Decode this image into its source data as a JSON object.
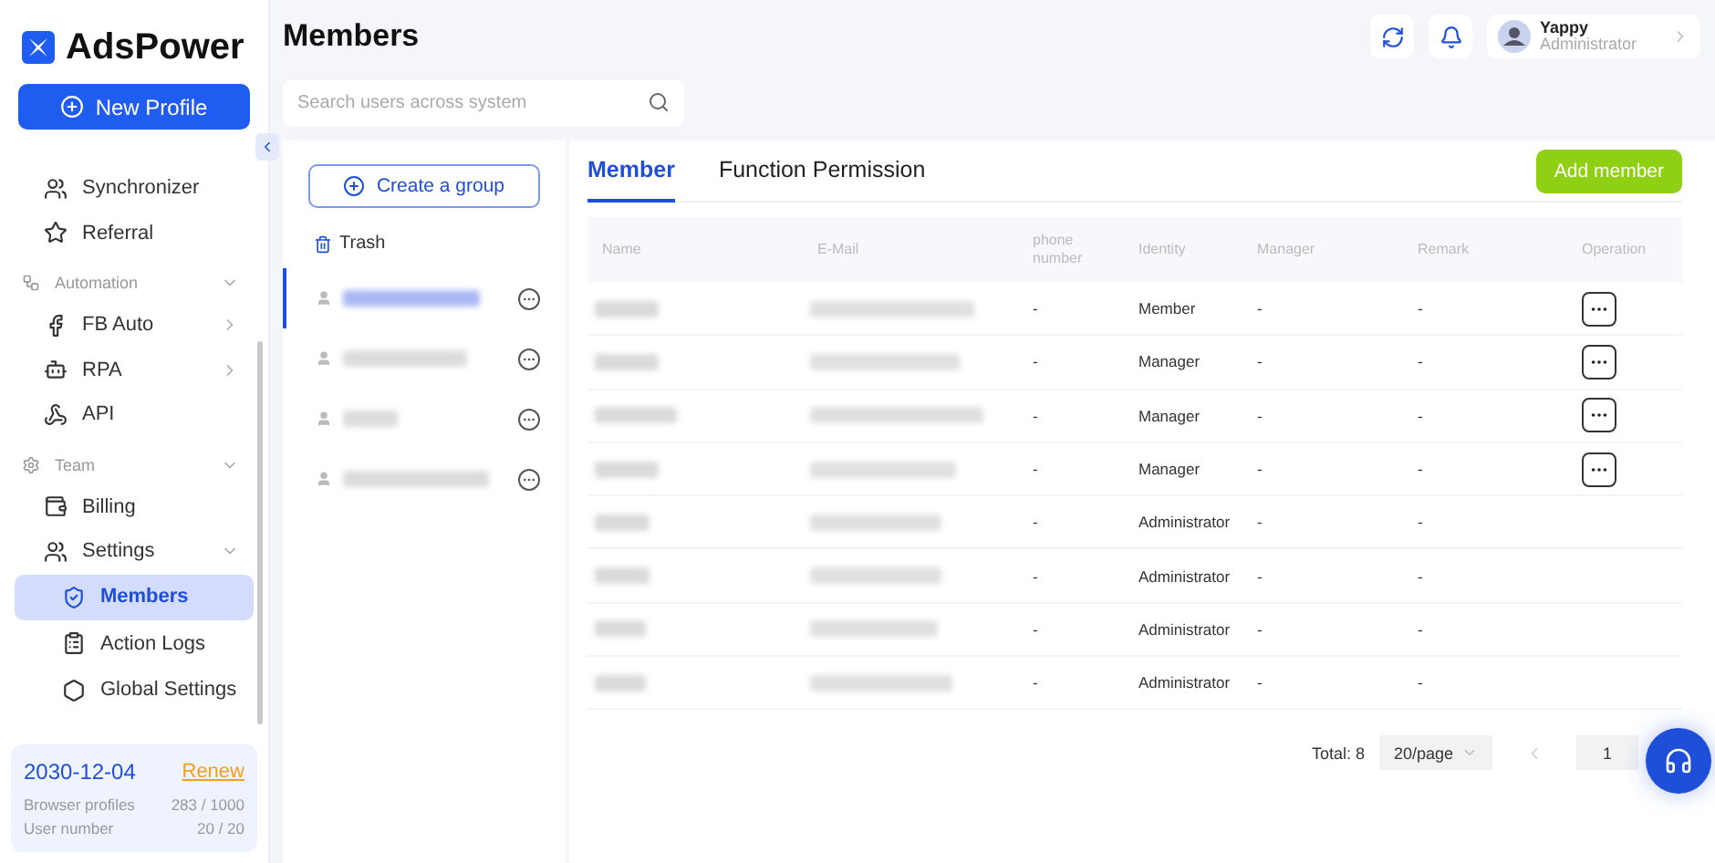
{
  "brand": "AdsPower",
  "new_profile": "New Profile",
  "nav": [
    {
      "kind": "item",
      "label": "Synchronizer",
      "selected": false
    },
    {
      "kind": "item",
      "label": "Referral",
      "selected": false
    },
    {
      "kind": "section",
      "label": "Automation",
      "expanded": true,
      "selected": false
    },
    {
      "kind": "item",
      "label": "FB Auto",
      "expanded": false,
      "selected": false
    },
    {
      "kind": "item",
      "label": "RPA",
      "expanded": false,
      "selected": false
    },
    {
      "kind": "item",
      "label": "API",
      "selected": false
    },
    {
      "kind": "section",
      "label": "Team",
      "expanded": true,
      "selected": false
    },
    {
      "kind": "item",
      "label": "Billing",
      "selected": false
    },
    {
      "kind": "item",
      "label": "Settings",
      "expanded": true,
      "selected": false
    },
    {
      "kind": "sub",
      "label": "Members",
      "selected": true
    },
    {
      "kind": "sub",
      "label": "Action Logs",
      "selected": false
    },
    {
      "kind": "sub",
      "label": "Global Settings",
      "selected": false
    }
  ],
  "plan": {
    "expiry": "2030-12-04",
    "renew": "Renew",
    "stats": [
      {
        "label": "Browser profiles",
        "value": "283 / 1000"
      },
      {
        "label": "User number",
        "value": "20 / 20"
      }
    ]
  },
  "page_title": "Members",
  "search": {
    "placeholder": "Search users across system"
  },
  "user": {
    "name": "Yappy",
    "role": "Administrator"
  },
  "create_group": "Create a group",
  "trash": "Trash",
  "groups": [
    {
      "selected": true
    },
    {
      "selected": false
    },
    {
      "selected": false
    },
    {
      "selected": false
    }
  ],
  "tabs": [
    {
      "label": "Member",
      "selected": true
    },
    {
      "label": "Function Permission",
      "selected": false
    }
  ],
  "add_member": "Add member",
  "columns": [
    "Name",
    "E-Mail",
    "phone number",
    "Identity",
    "Manager",
    "Remark",
    "Operation"
  ],
  "rows": [
    {
      "phone": "-",
      "identity": "Member",
      "manager": "-",
      "remark": "-",
      "operation": true
    },
    {
      "phone": "-",
      "identity": "Manager",
      "manager": "-",
      "remark": "-",
      "operation": true
    },
    {
      "phone": "-",
      "identity": "Manager",
      "manager": "-",
      "remark": "-",
      "operation": true
    },
    {
      "phone": "-",
      "identity": "Manager",
      "manager": "-",
      "remark": "-",
      "operation": true
    },
    {
      "phone": "-",
      "identity": "Administrator",
      "manager": "-",
      "remark": "-",
      "operation": false
    },
    {
      "phone": "-",
      "identity": "Administrator",
      "manager": "-",
      "remark": "-",
      "operation": false
    },
    {
      "phone": "-",
      "identity": "Administrator",
      "manager": "-",
      "remark": "-",
      "operation": false
    },
    {
      "phone": "-",
      "identity": "Administrator",
      "manager": "-",
      "remark": "-",
      "operation": false
    }
  ],
  "pagination": {
    "total": "Total: 8",
    "page_size": "20/page",
    "page": "1"
  }
}
